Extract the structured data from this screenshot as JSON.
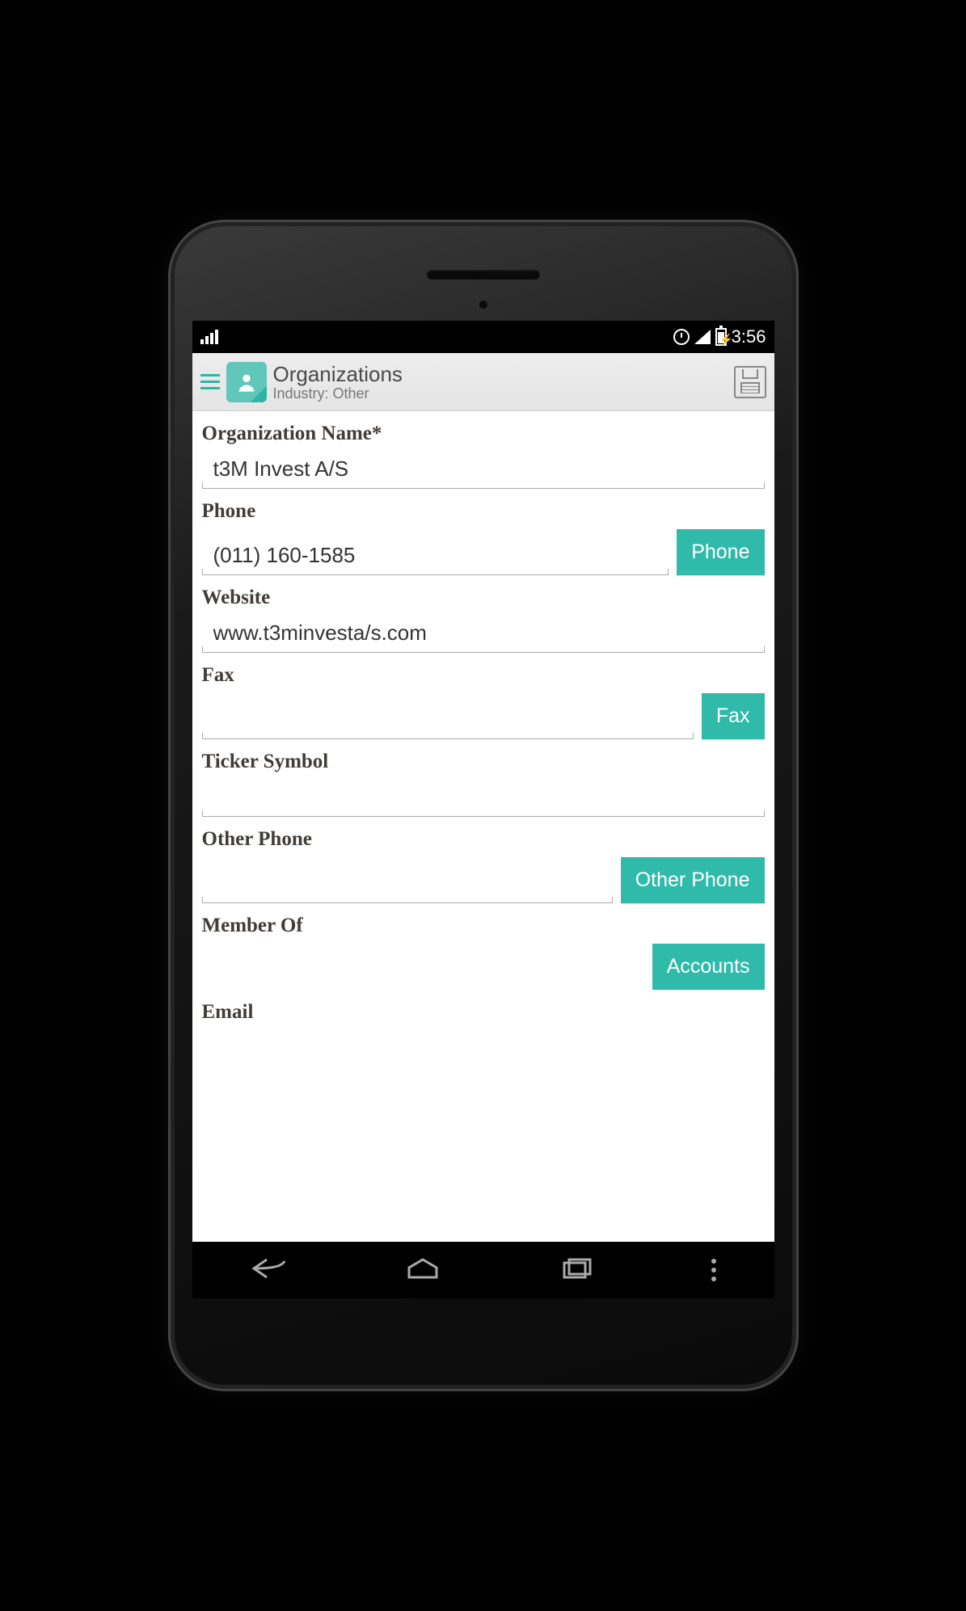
{
  "status": {
    "time": "3:56"
  },
  "header": {
    "title": "Organizations",
    "subtitle": "Industry: Other"
  },
  "form": {
    "org_name": {
      "label": "Organization Name*",
      "value": "t3M Invest A/S"
    },
    "phone": {
      "label": "Phone",
      "value": "(011) 160-1585",
      "button": "Phone"
    },
    "website": {
      "label": "Website",
      "value": "www.t3minvesta/s.com"
    },
    "fax": {
      "label": "Fax",
      "value": "",
      "button": "Fax"
    },
    "ticker": {
      "label": "Ticker Symbol",
      "value": ""
    },
    "other_phone": {
      "label": "Other Phone",
      "value": "",
      "button": "Other Phone"
    },
    "member_of": {
      "label": "Member Of",
      "button": "Accounts"
    },
    "email": {
      "label": "Email"
    }
  }
}
